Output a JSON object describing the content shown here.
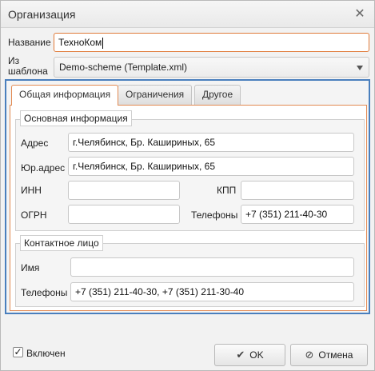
{
  "window": {
    "title": "Организация"
  },
  "form": {
    "name_label": "Название",
    "name_value": "ТехноКом",
    "template_label_line1": "Из",
    "template_label_line2": "шаблона",
    "template_value": "Demo-scheme (Template.xml)"
  },
  "tabs": [
    {
      "label": "Общая информация",
      "active": true
    },
    {
      "label": "Ограничения",
      "active": false
    },
    {
      "label": "Другое",
      "active": false
    }
  ],
  "basic_info": {
    "legend": "Основная информация",
    "address_label": "Адрес",
    "address_value": "г.Челябинск, Бр. Кашириных, 65",
    "legal_address_label": "Юр.адрес",
    "legal_address_value": "г.Челябинск, Бр. Кашириных, 65",
    "inn_label": "ИНН",
    "inn_value": "",
    "kpp_label": "КПП",
    "kpp_value": "",
    "ogrn_label": "ОГРН",
    "ogrn_value": "",
    "phones_label": "Телефоны",
    "phones_value": "+7 (351) 211-40-30"
  },
  "contact": {
    "legend": "Контактное лицо",
    "name_label": "Имя",
    "name_value": "",
    "phones_label": "Телефоны",
    "phones_value": "+7 (351) 211-40-30, +7 (351) 211-30-40"
  },
  "footer": {
    "enabled_label": "Включен",
    "enabled_checked": true,
    "ok_label": "OK",
    "cancel_label": "Отмена"
  },
  "colors": {
    "accent_orange": "#e28a52",
    "frame_blue": "#4a7fbd"
  }
}
